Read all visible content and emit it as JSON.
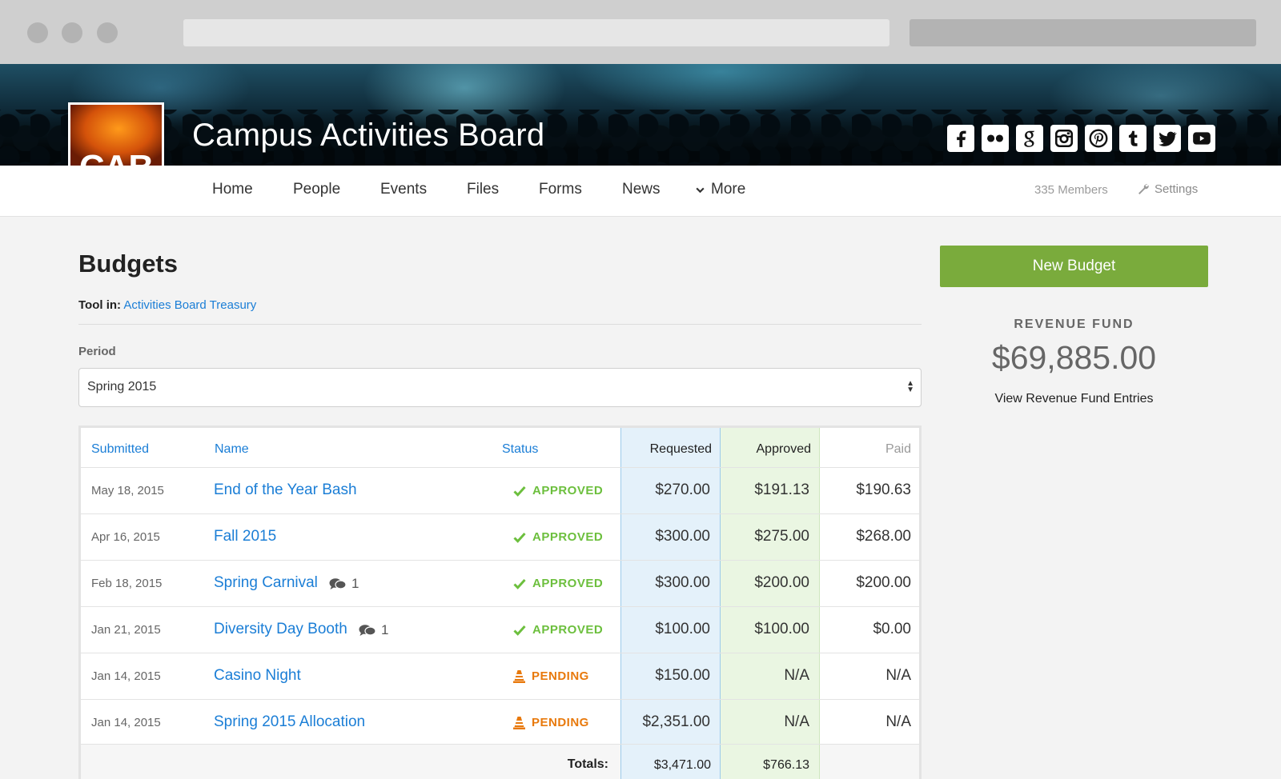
{
  "app": {
    "title": "Campus Activities Board",
    "logo_text": "CAB",
    "social_icons": [
      "facebook-icon",
      "flickr-icon",
      "google-plus-icon",
      "instagram-icon",
      "pinterest-icon",
      "tumblr-icon",
      "twitter-icon",
      "youtube-icon"
    ]
  },
  "nav": {
    "items": [
      "Home",
      "People",
      "Events",
      "Files",
      "Forms",
      "News"
    ],
    "more_label": "More",
    "members": "335 Members",
    "settings_label": "Settings"
  },
  "page": {
    "title": "Budgets",
    "tool_in_label": "Tool in:",
    "tool_in_link": "Activities Board Treasury",
    "period_label": "Period",
    "period_value": "Spring 2015"
  },
  "table": {
    "headers": {
      "submitted": "Submitted",
      "name": "Name",
      "status": "Status",
      "requested": "Requested",
      "approved": "Approved",
      "paid": "Paid"
    },
    "rows": [
      {
        "date": "May 18, 2015",
        "name": "End of the Year Bash",
        "comments": "",
        "status": "APPROVED",
        "requested": "$270.00",
        "approved": "$191.13",
        "paid": "$190.63"
      },
      {
        "date": "Apr 16, 2015",
        "name": "Fall 2015",
        "comments": "",
        "status": "APPROVED",
        "requested": "$300.00",
        "approved": "$275.00",
        "paid": "$268.00"
      },
      {
        "date": "Feb 18, 2015",
        "name": "Spring Carnival",
        "comments": "1",
        "status": "APPROVED",
        "requested": "$300.00",
        "approved": "$200.00",
        "paid": "$200.00"
      },
      {
        "date": "Jan 21, 2015",
        "name": "Diversity Day Booth",
        "comments": "1",
        "status": "APPROVED",
        "requested": "$100.00",
        "approved": "$100.00",
        "paid": "$0.00"
      },
      {
        "date": "Jan 14, 2015",
        "name": "Casino Night",
        "comments": "",
        "status": "PENDING",
        "requested": "$150.00",
        "approved": "N/A",
        "paid": "N/A"
      },
      {
        "date": "Jan 14, 2015",
        "name": "Spring 2015 Allocation",
        "comments": "",
        "status": "PENDING",
        "requested": "$2,351.00",
        "approved": "N/A",
        "paid": "N/A"
      }
    ],
    "totals_label": "Totals:",
    "totals_requested": "$3,471.00",
    "totals_approved": "$766.13"
  },
  "sidebar": {
    "new_budget_label": "New Budget",
    "fund_label": "REVENUE FUND",
    "fund_value": "$69,885.00",
    "fund_link": "View Revenue Fund Entries"
  },
  "colors": {
    "accent_link": "#1b7ed6",
    "button_green": "#7aab3c",
    "approved_green": "#6cbf3d",
    "pending_orange": "#e8790c",
    "requested_col_bg": "#e4f1fa",
    "approved_col_bg": "#eaf6e2"
  }
}
